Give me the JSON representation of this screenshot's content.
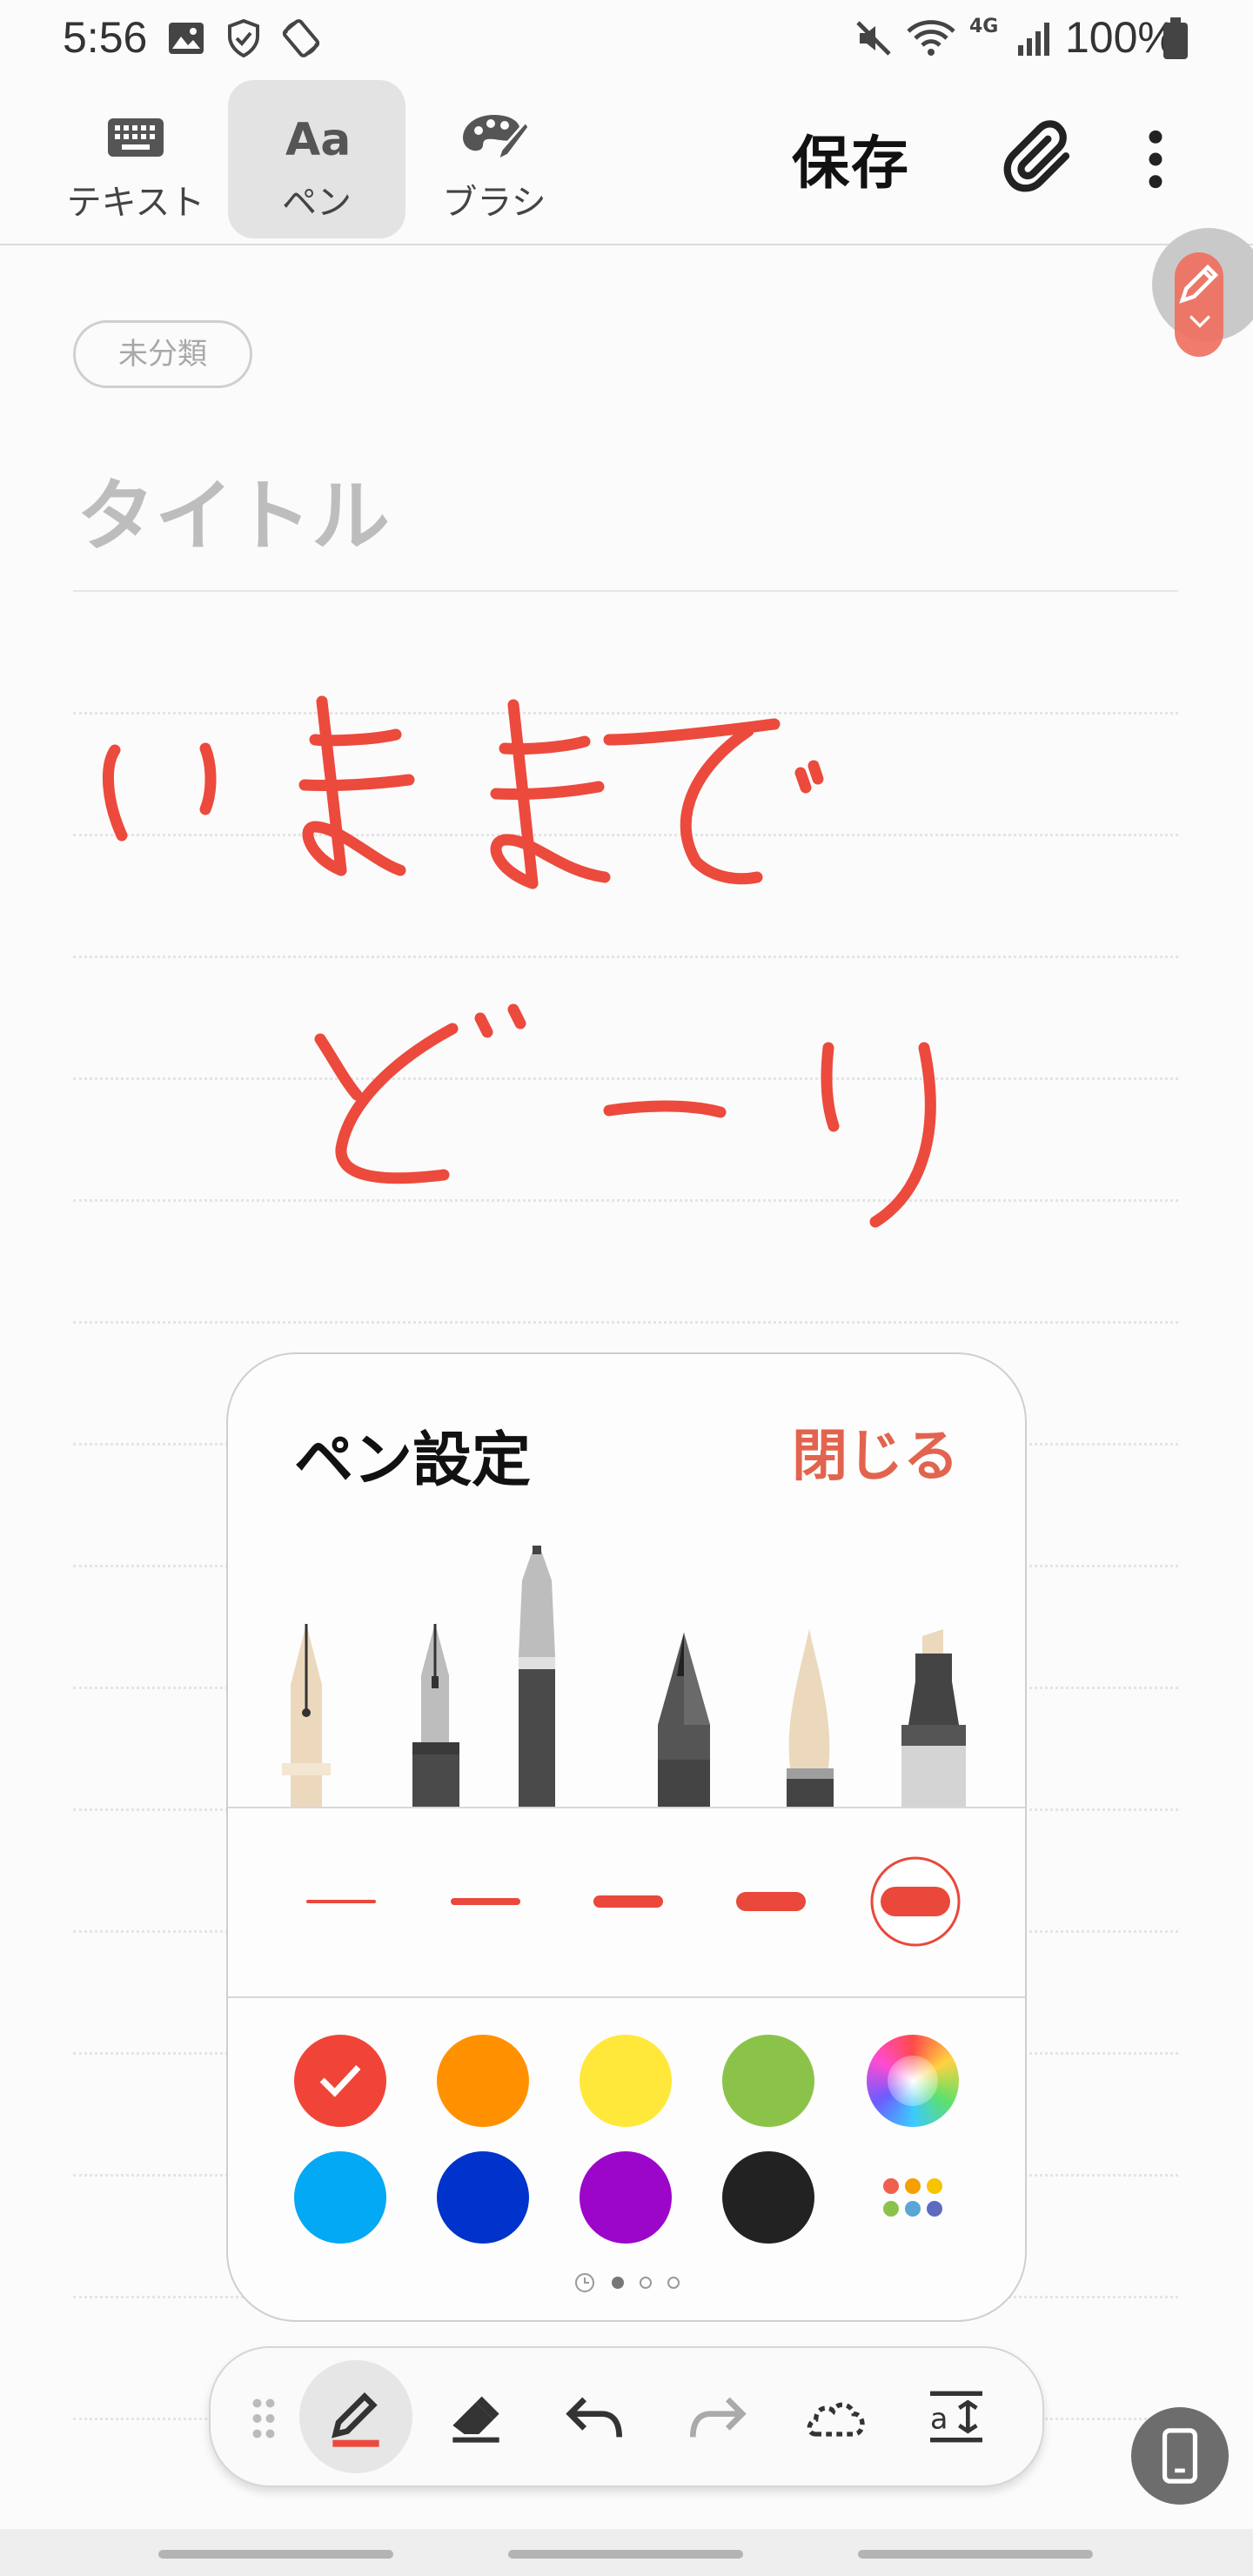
{
  "status_bar": {
    "time": "5:56",
    "battery": "100%",
    "network": "4G",
    "icons": [
      "image-icon",
      "shield-icon",
      "rotate-icon",
      "mute-icon",
      "wifi-icon",
      "signal-icon",
      "battery-icon"
    ]
  },
  "toolbar": {
    "tabs": [
      {
        "label": "テキスト",
        "icon": "keyboard-icon",
        "active": false
      },
      {
        "label": "ペン",
        "icon": "text-aa-icon",
        "active": true
      },
      {
        "label": "ブラシ",
        "icon": "palette-brush-icon",
        "active": false
      }
    ],
    "save_label": "保存",
    "attach_icon": "paperclip-icon",
    "more_icon": "more-vertical-icon"
  },
  "note": {
    "category": "未分類",
    "title_placeholder": "タイトル"
  },
  "pen_settings": {
    "title": "ペン設定",
    "close_label": "閉じる",
    "pens": [
      "fountain-pen-light",
      "fountain-pen",
      "ballpoint-pen",
      "pencil",
      "calligraphy-brush",
      "marker"
    ],
    "selected_size_index": 4,
    "colors": [
      {
        "hex": "#f04438",
        "selected": true
      },
      {
        "hex": "#ff9100",
        "selected": false
      },
      {
        "hex": "#ffe83a",
        "selected": false
      },
      {
        "hex": "#8bc34a",
        "selected": false
      },
      {
        "hex": "spectrum",
        "selected": false
      },
      {
        "hex": "#03a9f4",
        "selected": false
      },
      {
        "hex": "#0033cc",
        "selected": false
      },
      {
        "hex": "#9c06c9",
        "selected": false
      },
      {
        "hex": "#222222",
        "selected": false
      },
      {
        "hex": "more-colors",
        "selected": false
      }
    ],
    "page_count": 3,
    "current_page": 1
  },
  "bottom_toolbar": {
    "tools": [
      "drag-handle-icon",
      "pen-icon",
      "eraser-icon",
      "undo-icon",
      "redo-icon",
      "lasso-icon",
      "text-convert-icon"
    ],
    "active_tool": "pen-icon"
  },
  "accent_color": "#e2644e",
  "ink_color": "#f04438"
}
